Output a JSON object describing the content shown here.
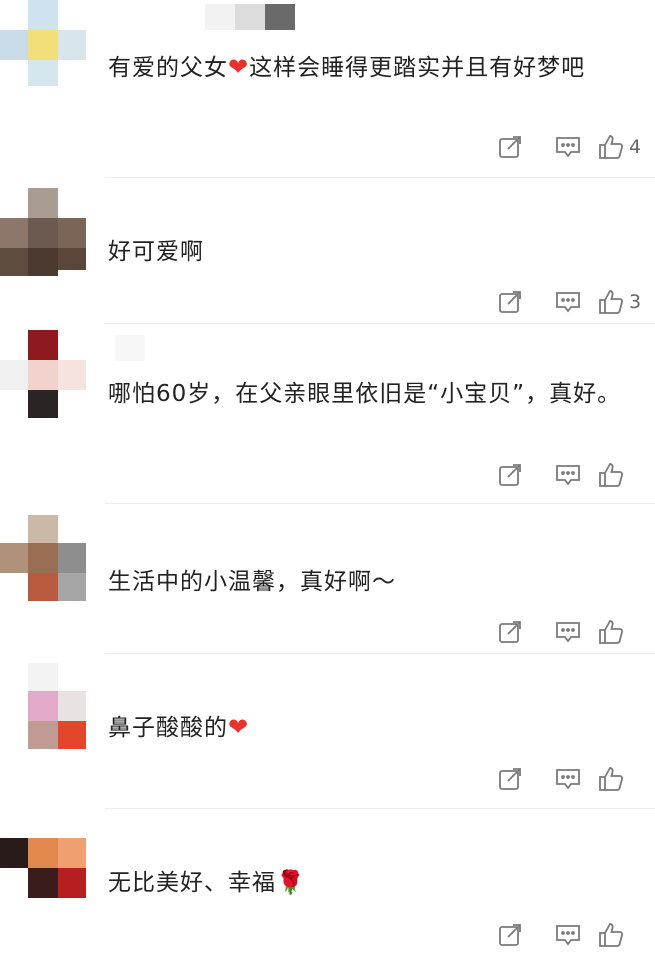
{
  "comments": [
    {
      "text": "有爱的父女",
      "text_after": "这样会睡得更踏实并且有好梦吧",
      "has_heart": true,
      "likes": "4"
    },
    {
      "text": "好可爱啊",
      "likes": "3"
    },
    {
      "text": "哪怕60岁，在父亲眼里依旧是“小宝贝”，真好。",
      "likes": ""
    },
    {
      "text": "生活中的小温馨，真好啊～",
      "likes": ""
    },
    {
      "text": "鼻子酸酸的",
      "has_heart_end": true,
      "likes": ""
    },
    {
      "text": "无比美好、幸福🌹",
      "likes": ""
    }
  ],
  "icons": {
    "share": "share-icon",
    "reply": "comment-icon",
    "like": "thumbs-up-icon",
    "heart": "heart-emoji-icon"
  },
  "colors": {
    "heart": "#e8332d",
    "icon": "#7a7a7a"
  }
}
